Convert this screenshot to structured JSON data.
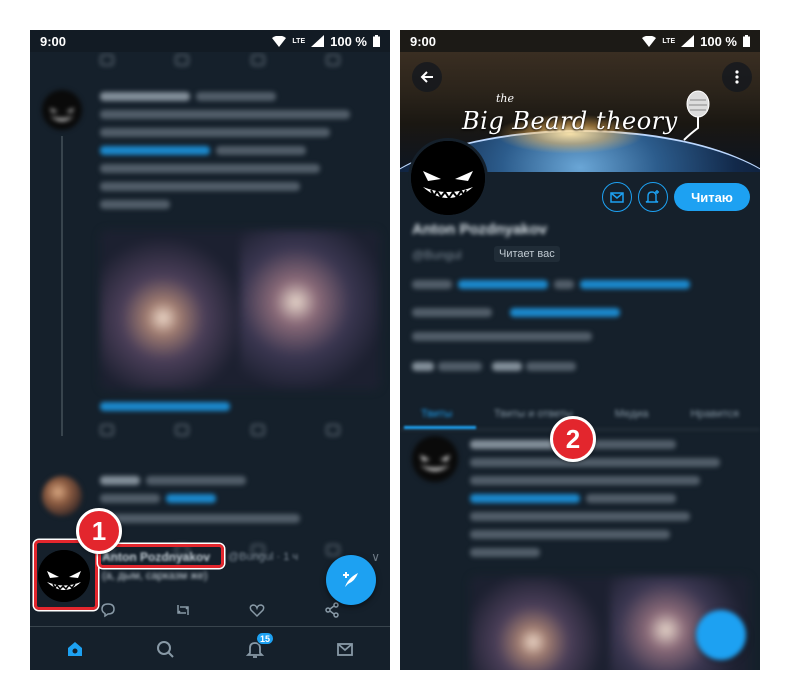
{
  "left_screen": {
    "status_bar": {
      "time": "9:00",
      "network": "LTE",
      "battery": "100 %"
    },
    "target_tweet": {
      "author_name": "Anton Pozdnyakov",
      "handle": "@Bungul · 1 ч",
      "text": "(а, дым, сарказм же)"
    },
    "bottom_nav": {
      "notifications_count": "15"
    },
    "step_marker": "1"
  },
  "right_screen": {
    "status_bar": {
      "time": "9:00",
      "network": "LTE",
      "battery": "100 %"
    },
    "banner": {
      "the_text": "the",
      "title_text": "Big Beard theory"
    },
    "profile": {
      "name": "Anton Pozdnyakov",
      "handle": "@Bungul",
      "follows_you_label": "Читает вас",
      "follow_button_label": "Читаю"
    },
    "tabs": [
      "Твиты",
      "Твиты и ответы",
      "Медиа",
      "Нравится"
    ],
    "step_marker": "2"
  },
  "colors": {
    "background": "#15202b",
    "accent": "#1da1f2",
    "highlight": "#e3262d"
  }
}
